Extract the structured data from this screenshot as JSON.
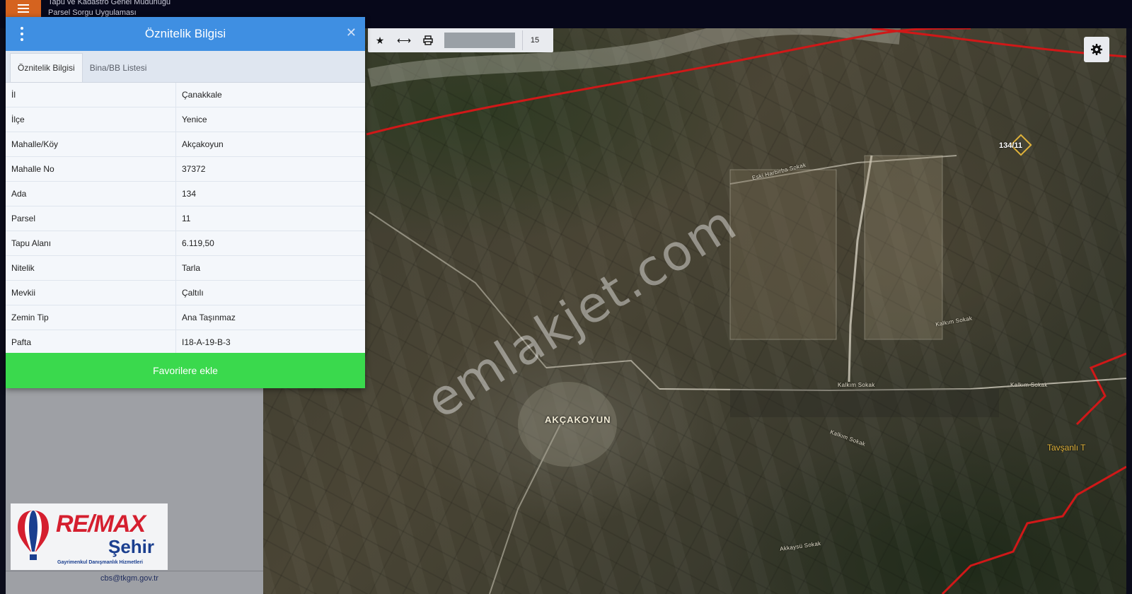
{
  "header": {
    "agency": "Tapu ve Kadastro Genel Müdürlüğü",
    "app_name": "Parsel Sorgu Uygulaması"
  },
  "map": {
    "village_label": "AKÇAKOYUN",
    "area_label": "Tavşanlı T",
    "parcel_label": "134/11",
    "street_labels": [
      "Kalkım Sokak",
      "Kalkım Sokak",
      "Kalkım Sokak",
      "Akkaysü Sokak",
      "Kalkım Sokak",
      "Eski Harbirba Sokak"
    ],
    "watermark": "emlakjet.com"
  },
  "toolbar": {
    "zoom_level": "15",
    "icons": [
      "star-icon",
      "measure-icon",
      "print-icon"
    ]
  },
  "panel": {
    "title": "Öznitelik Bilgisi",
    "tabs": [
      {
        "label": "Öznitelik Bilgisi",
        "active": true
      },
      {
        "label": "Bina/BB Listesi",
        "active": false
      }
    ],
    "rows": [
      {
        "key": "İl",
        "value": "Çanakkale"
      },
      {
        "key": "İlçe",
        "value": "Yenice"
      },
      {
        "key": "Mahalle/Köy",
        "value": "Akçakoyun"
      },
      {
        "key": "Mahalle No",
        "value": "37372"
      },
      {
        "key": "Ada",
        "value": "134"
      },
      {
        "key": "Parsel",
        "value": "11"
      },
      {
        "key": "Tapu Alanı",
        "value": "6.119,50"
      },
      {
        "key": "Nitelik",
        "value": "Tarla"
      },
      {
        "key": "Mevkii",
        "value": "Çaltılı"
      },
      {
        "key": "Zemin Tip",
        "value": "Ana Taşınmaz"
      },
      {
        "key": "Pafta",
        "value": "I18-A-19-B-3"
      }
    ],
    "favorite_button": "Favorilere ekle"
  },
  "sidebar": {
    "email": "cbs@tkgm.gov.tr"
  },
  "logo": {
    "brand": "RE/MAX",
    "city": "Şehir",
    "tagline": "Gayrimenkul Danışmanlık Hizmetleri"
  },
  "colors": {
    "header_blue": "#3f8fe2",
    "favorite_green": "#3ad94d",
    "menu_orange": "#d5631f",
    "boundary_red": "#d01818",
    "remax_red": "#d51f2f",
    "remax_blue": "#1b3f8f"
  }
}
